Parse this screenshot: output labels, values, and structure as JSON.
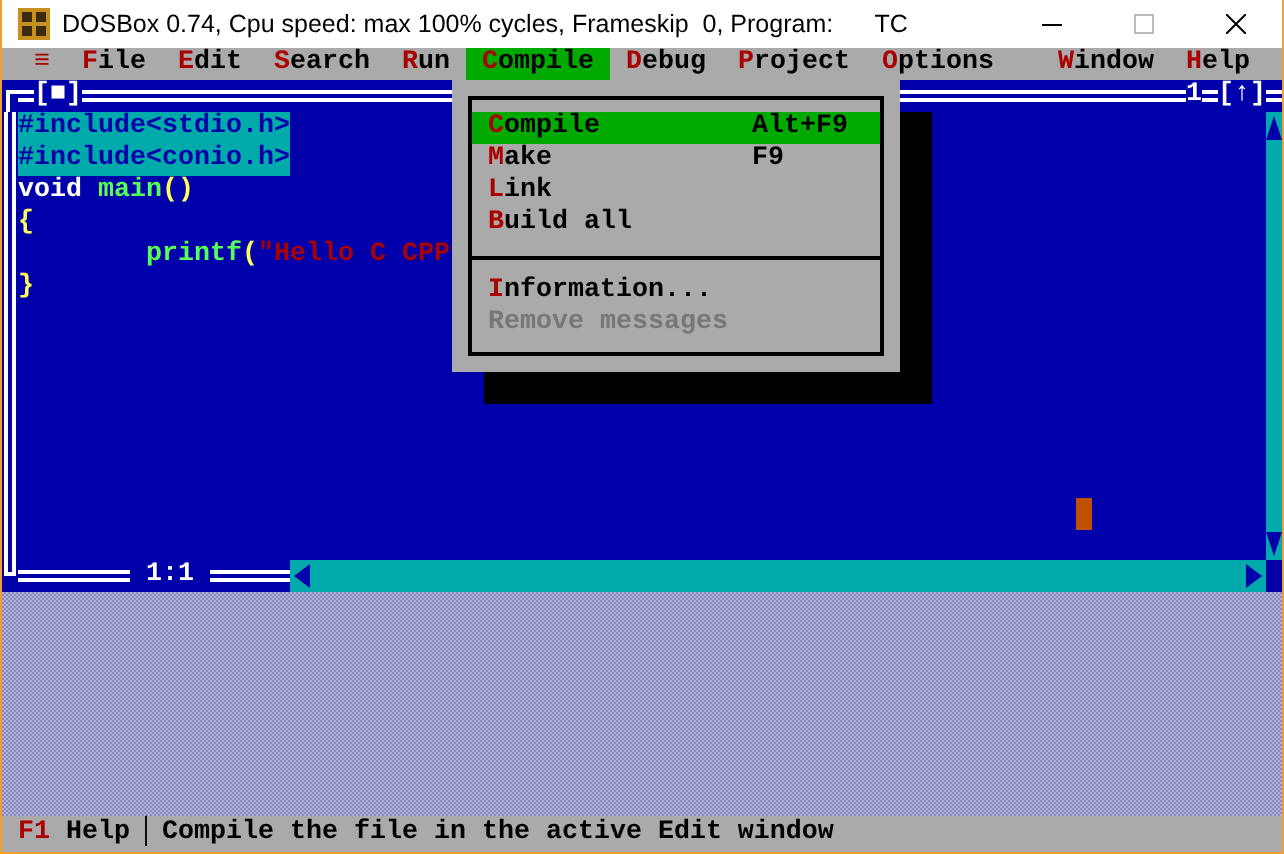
{
  "window": {
    "title": "DOSBox 0.74, Cpu speed: max 100% cycles, Frameskip  0, Program:      TC"
  },
  "menu_bar": [
    {
      "kind": "system",
      "label": "≡",
      "selected": false
    },
    {
      "kind": "menu",
      "hot": "F",
      "rest": "ile",
      "selected": false
    },
    {
      "kind": "menu",
      "hot": "E",
      "rest": "dit",
      "selected": false
    },
    {
      "kind": "menu",
      "hot": "S",
      "rest": "earch",
      "selected": false
    },
    {
      "kind": "menu",
      "hot": "R",
      "rest": "un",
      "selected": false
    },
    {
      "kind": "menu",
      "hot": "C",
      "rest": "ompile",
      "selected": true
    },
    {
      "kind": "menu",
      "hot": "D",
      "rest": "ebug",
      "selected": false
    },
    {
      "kind": "menu",
      "hot": "P",
      "rest": "roject",
      "selected": false
    },
    {
      "kind": "menu",
      "hot": "O",
      "rest": "ptions",
      "selected": false
    },
    {
      "kind": "gap"
    },
    {
      "kind": "menu",
      "hot": "W",
      "rest": "indow",
      "selected": false
    },
    {
      "kind": "menu",
      "hot": "H",
      "rest": "elp",
      "selected": false
    }
  ],
  "editor": {
    "close_box": "[■]",
    "number": "1",
    "zoom_box": "[↑]",
    "position": "1:1",
    "lines": [
      {
        "selected": true,
        "tokens": [
          {
            "kind": "directive",
            "text": "#include<stdio.h>"
          }
        ]
      },
      {
        "selected": true,
        "tokens": [
          {
            "kind": "directive",
            "text": "#include<conio.h>"
          }
        ]
      },
      {
        "selected": false,
        "tokens": [
          {
            "kind": "keyword",
            "text": "void"
          },
          {
            "kind": "ident",
            "text": " main"
          },
          {
            "kind": "punct",
            "text": "()"
          }
        ]
      },
      {
        "selected": false,
        "tokens": [
          {
            "kind": "punct",
            "text": "{"
          }
        ]
      },
      {
        "selected": false,
        "tokens": [
          {
            "kind": "ident",
            "text": "        printf"
          },
          {
            "kind": "punct",
            "text": "("
          },
          {
            "kind": "string",
            "text": "\"Hello C CPP"
          }
        ]
      },
      {
        "selected": false,
        "tokens": [
          {
            "kind": "punct",
            "text": "}"
          }
        ]
      }
    ]
  },
  "compile_menu": [
    {
      "kind": "command",
      "hot": "C",
      "rest": "ompile",
      "shortcut": "Alt+F9",
      "selected": true,
      "disabled": false
    },
    {
      "kind": "command",
      "hot": "M",
      "rest": "ake",
      "shortcut": "F9",
      "selected": false,
      "disabled": false
    },
    {
      "kind": "command",
      "hot": "L",
      "rest": "ink",
      "selected": false,
      "disabled": false
    },
    {
      "kind": "command",
      "hot": "B",
      "rest": "uild all",
      "selected": false,
      "disabled": false
    },
    {
      "kind": "separator"
    },
    {
      "kind": "command",
      "hot": "I",
      "rest": "nformation...",
      "selected": false,
      "disabled": false
    },
    {
      "kind": "command",
      "hot": "R",
      "rest": "emove messages",
      "selected": false,
      "disabled": true
    }
  ],
  "status_bar": {
    "key": "F1",
    "key_label": " Help",
    "divider": "│",
    "message": "Compile the file in the active Edit window"
  }
}
